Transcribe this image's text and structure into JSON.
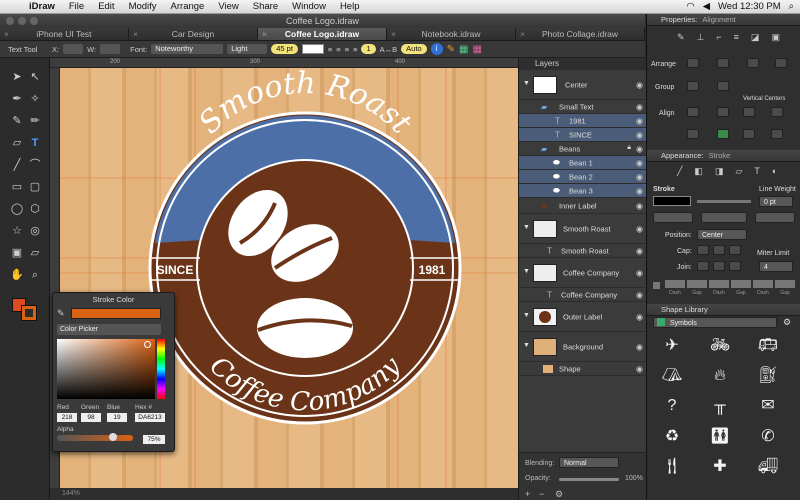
{
  "menubar": {
    "app": "iDraw",
    "items": [
      "File",
      "Edit",
      "Modify",
      "Arrange",
      "View",
      "Share",
      "Window",
      "Help"
    ],
    "clock": "Wed 12:30 PM"
  },
  "window": {
    "title": "Coffee Logo.idraw"
  },
  "tabs": [
    "iPhone UI Test",
    "Car Design",
    "Coffee Logo.idraw",
    "Notebook.idraw",
    "Photo Collage.idraw"
  ],
  "active_tab": 2,
  "tool_options": {
    "tool_name": "Text Tool",
    "x_label": "X:",
    "y_label": "Y:",
    "w_label": "W:",
    "h_label": "H:",
    "font_label": "Font:",
    "font": "Noteworthy",
    "weight": "Light",
    "size": "45 pt",
    "spacing": "1",
    "baseline_label": "A↔B",
    "baseline": "Auto"
  },
  "logo": {
    "top_text": "Smooth Roast",
    "bottom_text": "Coffee Company",
    "left_year": "SINCE",
    "right_year": "1981",
    "colors": {
      "brown": "#6B3418",
      "blue": "#4C6FA8",
      "white": "#FFFFFF"
    }
  },
  "statusbar": {
    "zoom": "144%"
  },
  "layers": {
    "title": "Layers",
    "rows": [
      {
        "name": "Center",
        "kind": "thumb-logo"
      },
      {
        "name": "Small Text",
        "kind": "folder"
      },
      {
        "name": "1981",
        "kind": "text"
      },
      {
        "name": "SINCE",
        "kind": "text"
      },
      {
        "name": "Beans",
        "kind": "folder"
      },
      {
        "name": "Bean 1",
        "kind": "bean"
      },
      {
        "name": "Bean 2",
        "kind": "bean"
      },
      {
        "name": "Bean 3",
        "kind": "bean"
      },
      {
        "name": "Inner Label",
        "kind": "circle"
      },
      {
        "name": "Smooth Roast",
        "kind": "thumb"
      },
      {
        "name": "Smooth Roast",
        "kind": "text"
      },
      {
        "name": "Coffee Company",
        "kind": "thumb"
      },
      {
        "name": "Coffee Company",
        "kind": "text"
      },
      {
        "name": "Outer Label",
        "kind": "thumb-circle"
      },
      {
        "name": "Background",
        "kind": "thumb-wood"
      },
      {
        "name": "Shape",
        "kind": "shape"
      }
    ],
    "blending_label": "Blending:",
    "blending": "Normal",
    "opacity_label": "Opacity:",
    "opacity": "100%"
  },
  "properties": {
    "header": "Properties:",
    "header_sub": "Alignment",
    "arrange_label": "Arrange",
    "group_label": "Group",
    "align_label": "Align",
    "vertical_centers": "Vertical Centers",
    "appearance_header": "Appearance:",
    "appearance_sub": "Stroke",
    "stroke_label": "Stroke",
    "line_weight_label": "Line Weight",
    "line_weight": "0 pt",
    "position_label": "Position:",
    "position": "Center",
    "cap_label": "Cap:",
    "join_label": "Join:",
    "miter_label": "Miter Limit",
    "miter": "4",
    "dash_labels": [
      "Dash",
      "Gap",
      "Dash",
      "Gap",
      "Dash",
      "Gap"
    ],
    "shape_library_header": "Shape Library",
    "symbols_set": "Symbols",
    "symbols": [
      "airplane-icon",
      "bicycle-icon",
      "bus-icon",
      "tent-icon",
      "campfire-icon",
      "gas-pump-icon",
      "help-icon",
      "picnic-table-icon",
      "mail-icon",
      "recycle-icon",
      "restroom-icon",
      "phone-icon",
      "restaurant-icon",
      "first-aid-icon",
      "tow-truck-icon"
    ]
  },
  "color_popover": {
    "title": "Stroke Color",
    "mode": "Color Picker",
    "labels": {
      "red": "Red",
      "green": "Green",
      "blue": "Blue",
      "hex": "Hex #",
      "alpha": "Alpha"
    },
    "red": "218",
    "green": "98",
    "blue": "19",
    "hex": "DA6213",
    "alpha": "75%",
    "color": "#DA6213"
  }
}
